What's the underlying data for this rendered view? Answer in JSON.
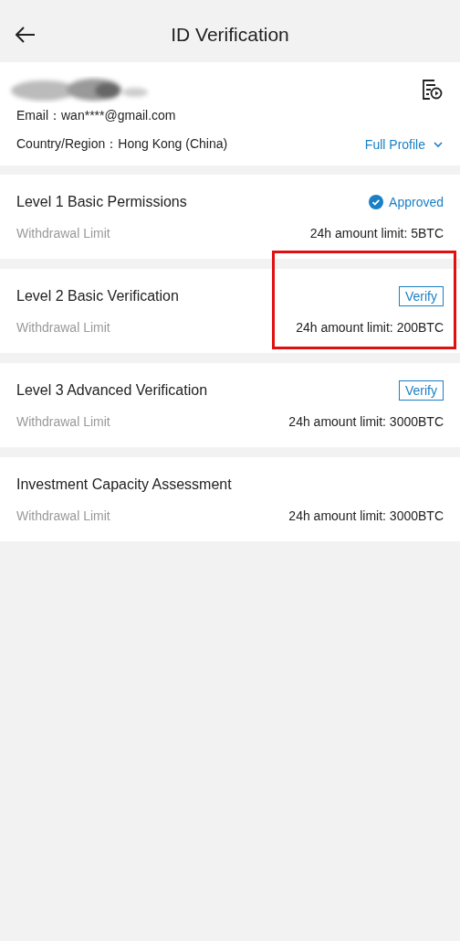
{
  "header": {
    "title": "ID Verification"
  },
  "profile": {
    "name_redacted": true,
    "email_label": "Email：",
    "email": "wan****@gmail.com",
    "region_label": "Country/Region：",
    "region": "Hong Kong (China)",
    "link": "Full Profile"
  },
  "levels": [
    {
      "title": "Level 1 Basic Permissions",
      "kind": "approved",
      "status_text": "Approved",
      "limit_label": "Withdrawal Limit",
      "limit": "24h amount limit: 5BTC",
      "highlighted": false
    },
    {
      "title": "Level 2 Basic Verification",
      "kind": "verify",
      "status_text": "Verify",
      "limit_label": "Withdrawal Limit",
      "limit": "24h amount limit: 200BTC",
      "highlighted": true
    },
    {
      "title": "Level 3 Advanced Verification",
      "kind": "verify",
      "status_text": "Verify",
      "limit_label": "Withdrawal Limit",
      "limit": "24h amount limit: 3000BTC",
      "highlighted": false
    },
    {
      "title": "Investment Capacity Assessment",
      "kind": "none",
      "limit_label": "Withdrawal Limit",
      "limit": "24h amount limit: 3000BTC",
      "highlighted": false
    }
  ]
}
